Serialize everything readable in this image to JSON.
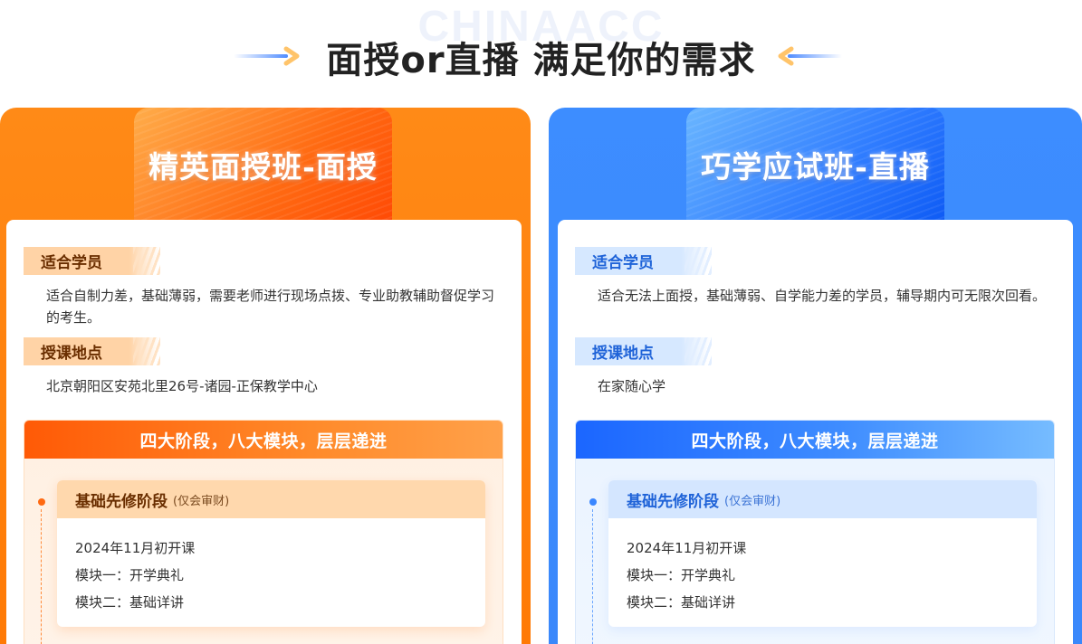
{
  "header": {
    "watermark": "CHINAACC",
    "title": "面授or直播 满足你的需求"
  },
  "colors": {
    "orange_accent": "#ff7a05",
    "blue_accent": "#3a88fb"
  },
  "cards": [
    {
      "tab_title": "精英面授班-面授",
      "audience_label": "适合学员",
      "audience_desc": "适合自制力差，基础薄弱，需要老师进行现场点拨、专业助教辅助督促学习的考生。",
      "location_label": "授课地点",
      "location_desc": "北京朝阳区安苑北里26号-诸园-正保教学中心",
      "stages_heading": "四大阶段，八大模块，层层递进",
      "stage": {
        "name": "基础先修阶段",
        "note": "(仅会审财)",
        "lines": [
          "2024年11月初开课",
          "模块一：开学典礼",
          "模块二：基础详讲"
        ]
      }
    },
    {
      "tab_title": "巧学应试班-直播",
      "audience_label": "适合学员",
      "audience_desc": "适合无法上面授，基础薄弱、自学能力差的学员，辅导期内可无限次回看。",
      "location_label": "授课地点",
      "location_desc": "在家随心学",
      "stages_heading": "四大阶段，八大模块，层层递进",
      "stage": {
        "name": "基础先修阶段",
        "note": "(仅会审财)",
        "lines": [
          "2024年11月初开课",
          "模块一：开学典礼",
          "模块二：基础详讲"
        ]
      }
    }
  ]
}
